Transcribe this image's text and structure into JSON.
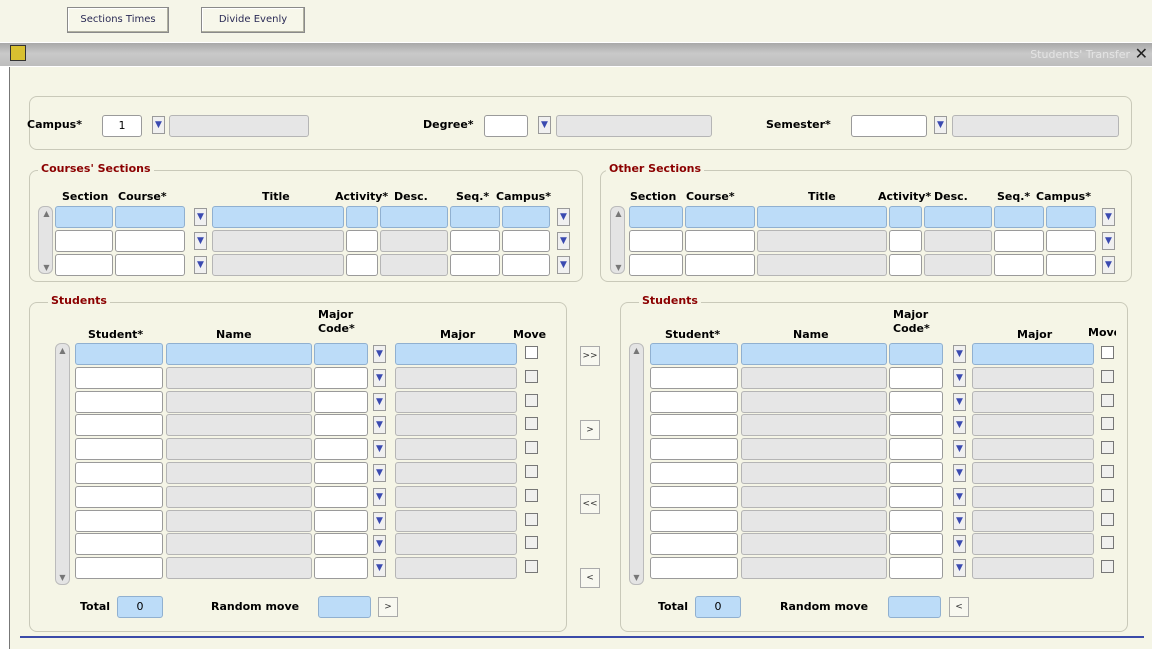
{
  "toolbar": {
    "btn1": "Sections Times",
    "btn2": "Divide Evenly"
  },
  "window": {
    "title": "Students' Transfer",
    "close": "✕"
  },
  "header": {
    "campus_label": "Campus*",
    "campus_value": "1",
    "degree_label": "Degree*",
    "semester_label": "Semester*"
  },
  "courses": {
    "title": "Courses' Sections",
    "cols": [
      "Section",
      "Course*",
      "Title",
      "Activity*",
      "Desc.",
      "Seq.*",
      "Campus*"
    ]
  },
  "other": {
    "title": "Other Sections",
    "cols": [
      "Section",
      "Course*",
      "Title",
      "Activity*",
      "Desc.",
      "Seq.*",
      "Campus*"
    ]
  },
  "students_left": {
    "title": "Students",
    "cols": {
      "student": "Student*",
      "name": "Name",
      "major_code": "Major Code*",
      "major": "Major",
      "move": "Move"
    },
    "total_label": "Total",
    "total_value": "0",
    "random_label": "Random move",
    "random_btn": ">"
  },
  "students_right": {
    "title": "Students",
    "cols": {
      "student": "Student*",
      "name": "Name",
      "major_code": "Major Code*",
      "major": "Major",
      "move": "Move"
    },
    "total_label": "Total",
    "total_value": "0",
    "random_label": "Random move",
    "random_btn": "<"
  },
  "transfer": {
    "all_right": ">>",
    "one_right": ">",
    "all_left": "<<",
    "one_left": "<"
  },
  "icons": {
    "lov": "list-of-values-icon",
    "scroll_up": "▲",
    "scroll_down": "▼"
  }
}
